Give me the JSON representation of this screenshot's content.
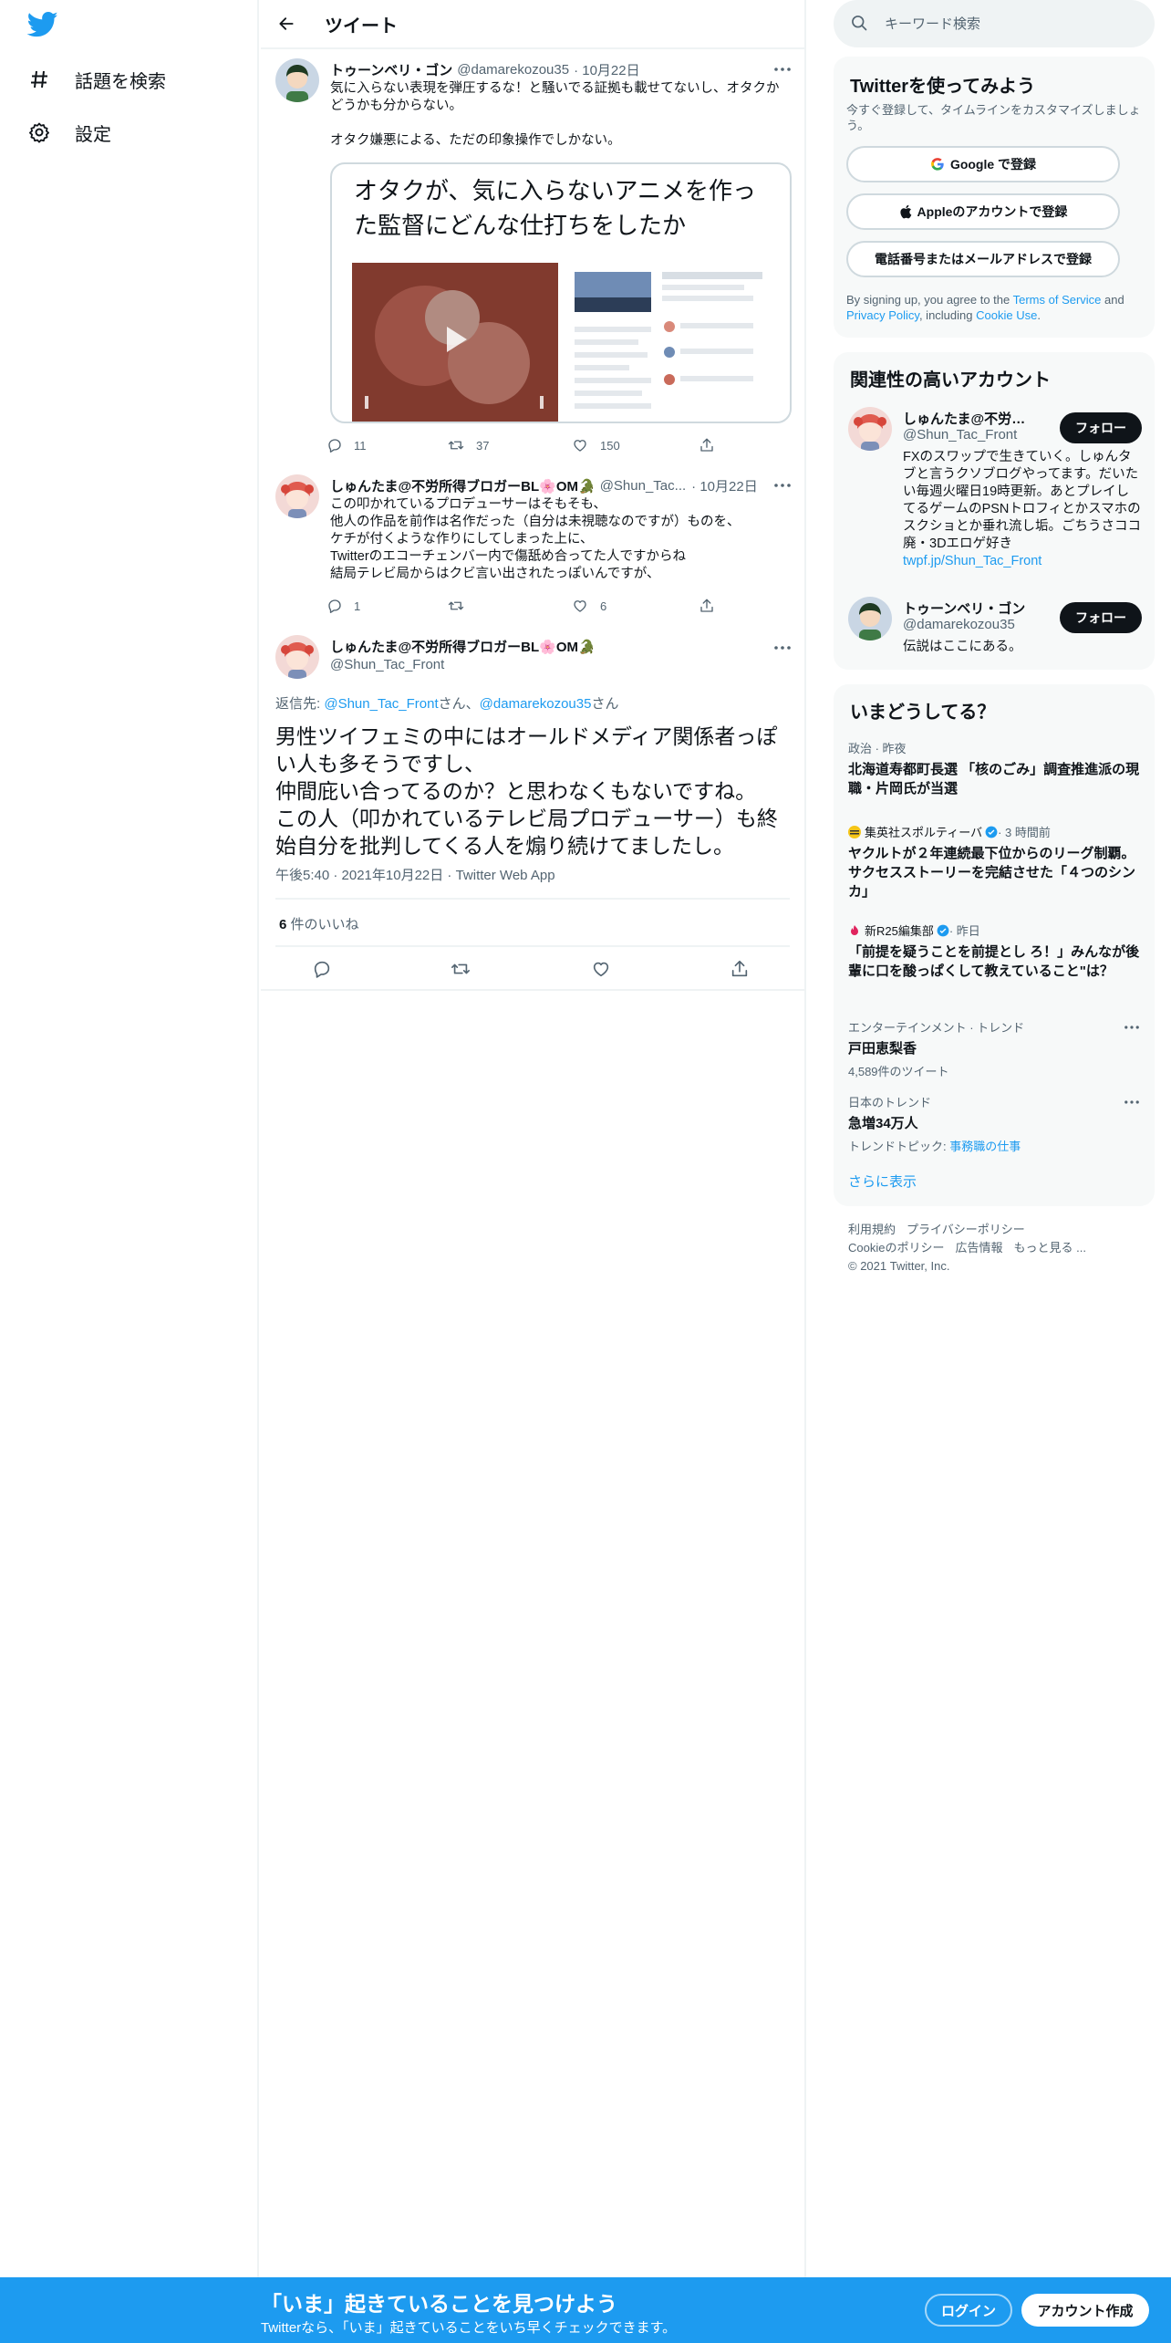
{
  "colors": {
    "accent": "#1d9bf0",
    "text": "#0f1419",
    "muted": "#536471",
    "border": "#eff3f4"
  },
  "nav": {
    "items": [
      {
        "label": "話題を検索",
        "icon": "hashtag-icon"
      },
      {
        "label": "設定",
        "icon": "gear-icon"
      }
    ]
  },
  "header": {
    "title": "ツイート"
  },
  "tweets": [
    {
      "name": "トゥーンベリ・ゴン",
      "handle": "@damarekozou35",
      "date": "· 10月22日",
      "text": "気に入らない表現を弾圧するな！と騒いでる証拠も載せてないし、オタクかどうかも分からない。\n\nオタク嫌悪による、ただの印象操作でしかない。",
      "card_title": "オタクが、気に入らないアニメを作った監督にどんな仕打ちをしたか",
      "replies": "11",
      "retweets": "37",
      "likes": "150"
    },
    {
      "name": "しゅんたま@不労所得ブロガーBL🌸OM🐊",
      "handle": "@Shun_Tac...",
      "date": "· 10月22日",
      "text": "この叩かれているプロデューサーはそもそも、\n他人の作品を前作は名作だった（自分は未視聴なのですが）ものを、\nケチが付くような作りにしてしまった上に、\nTwitterのエコーチェンバー内で傷舐め合ってた人ですからね\n結局テレビ局からはクビ言い出されたっぽいんですが、",
      "replies": "1",
      "retweets": "",
      "likes": "6"
    }
  ],
  "focal": {
    "name": "しゅんたま@不労所得ブロガーBL🌸OM🐊",
    "handle": "@Shun_Tac_Front",
    "reply_prefix": "返信先: ",
    "reply_user1": "@Shun_Tac_Front",
    "reply_sep": "さん、",
    "reply_user2": "@damarekozou35",
    "reply_suffix": "さん",
    "text": "男性ツイフェミの中にはオールドメディア関係者っぽい人も多そうですし、\n仲間庇い合ってるのか？と思わなくもないですね。\nこの人（叩かれているテレビ局プロデューサー）も終始自分を批判してくる人を煽り続けてましたし。",
    "meta": "午後5:40 · 2021年10月22日 · Twitter Web App",
    "likes_count": "6",
    "likes_label": " 件のいいね"
  },
  "search": {
    "placeholder": "キーワード検索"
  },
  "signup": {
    "title": "Twitterを使ってみよう",
    "subtitle": "今すぐ登録して、タイムラインをカスタマイズしましょう。",
    "google": "Google で登録",
    "apple": "Appleのアカウントで登録",
    "phone": "電話番号またはメールアドレスで登録",
    "legal_prefix": "By signing up, you agree to the ",
    "terms": "Terms of Service",
    "and": " and ",
    "privacy": "Privacy Policy",
    "including": ", including ",
    "cookie": "Cookie Use",
    "dot": "."
  },
  "relevant": {
    "title": "関連性の高いアカウント",
    "follow_label": "フォロー",
    "accounts": [
      {
        "name": "しゅんたま@不労所...",
        "handle": "@Shun_Tac_Front",
        "bio": "FXのスワップで生きていく。しゅんタブと言うクソブログやってます。だいたい毎週火曜日19時更新。あとプレイしてるゲームのPSNトロフィとかスマホのスクショとか垂れ流し垢。ごちうさココ廃・3Dエロゲ好き ",
        "link": "twpf.jp/Shun_Tac_Front"
      },
      {
        "name": "トゥーンベリ・ゴン",
        "handle": "@damarekozou35",
        "bio": "伝説はここにある。",
        "link": ""
      }
    ]
  },
  "trends": {
    "title": "いまどうしてる？",
    "items": [
      {
        "context": "政治 · 昨夜",
        "title": "北海道寿都町長選 「核のごみ」調査推進派の現職・片岡氏が当選",
        "count": ""
      },
      {
        "context": "集英社スポルティーバ",
        "context_suffix": " · 3 時間前",
        "title": "ヤクルトが２年連続最下位からのリーグ制覇。サクセスストーリーを完結させた「４つのシンカ」",
        "count": ""
      },
      {
        "context": "新R25編集部",
        "context_suffix": " · 昨日",
        "title": "「前提を疑うことを前提とし ろ！」みんなが後輩に口を酸っぱくして教えていること\"は？",
        "count": ""
      },
      {
        "context": "エンターテインメント · トレンド",
        "title": "戸田恵梨香",
        "count": "4,589件のツイート"
      },
      {
        "context": "日本のトレンド",
        "title": "急増34万人",
        "count_prefix": "トレンドトピック: ",
        "count_link": "事務職の仕事"
      }
    ],
    "show_more": "さらに表示"
  },
  "footer": {
    "links": [
      "利用規約",
      "プライバシーポリシー",
      "Cookieのポリシー",
      "広告情報",
      "もっと見る ..."
    ],
    "copyright": "© 2021 Twitter, Inc."
  },
  "banner": {
    "title": "「いま」起きていることを見つけよう",
    "subtitle": "Twitterなら、「いま」起きていることをいち早くチェックできます。",
    "login": "ログイン",
    "signup": "アカウント作成"
  }
}
